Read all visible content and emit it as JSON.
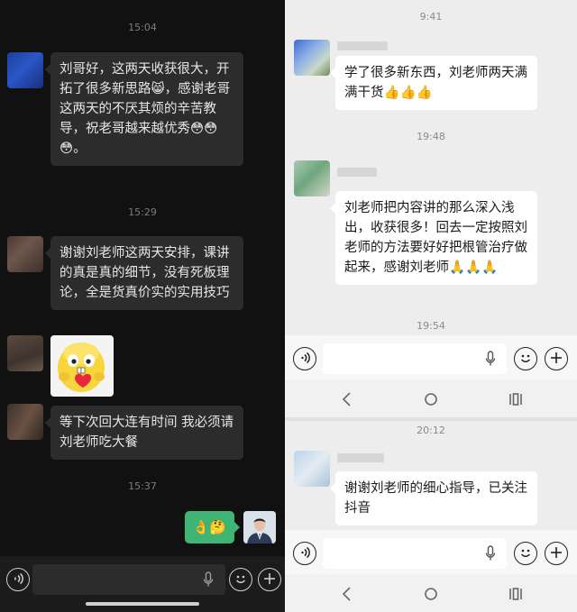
{
  "left_panel": {
    "timestamps": [
      "15:04",
      "15:29",
      "15:37"
    ],
    "messages": [
      {
        "text": "刘哥好，这两天收获很大，开拓了很多新思路😸，感谢老哥这两天的不厌其烦的辛苦教导，祝老哥越来越优秀😳😳😳。"
      },
      {
        "text": "谢谢刘老师这两天安排，课讲的真是真的细节，没有死板理论，全是货真价实的实用技巧"
      },
      {
        "text": "等下次回大连有时间 我必须请刘老师吃大餐"
      }
    ],
    "own_message": {
      "text": "👌🤔"
    }
  },
  "right_panel": {
    "timestamps": [
      "9:41",
      "19:48",
      "19:54",
      "20:12"
    ],
    "messages": [
      {
        "text": "学了很多新东西，刘老师两天满满干货👍👍👍"
      },
      {
        "text": "刘老师把内容讲的那么深入浅出，收获很多！回去一定按照刘老师的方法要好好把根管治疗做起来，感谢刘老师🙏🙏🙏"
      },
      {
        "text": "谢谢刘老师的细心指导，已关注抖音"
      }
    ]
  },
  "colors": {
    "dark_bg": "#111111",
    "dark_bubble": "#2c2c2c",
    "own_bubble": "#3eb575",
    "light_bg": "#ededed"
  },
  "icons": [
    "voice-icon",
    "microphone-icon",
    "emoji-icon",
    "plus-icon",
    "back-icon",
    "home-icon",
    "recents-icon"
  ]
}
